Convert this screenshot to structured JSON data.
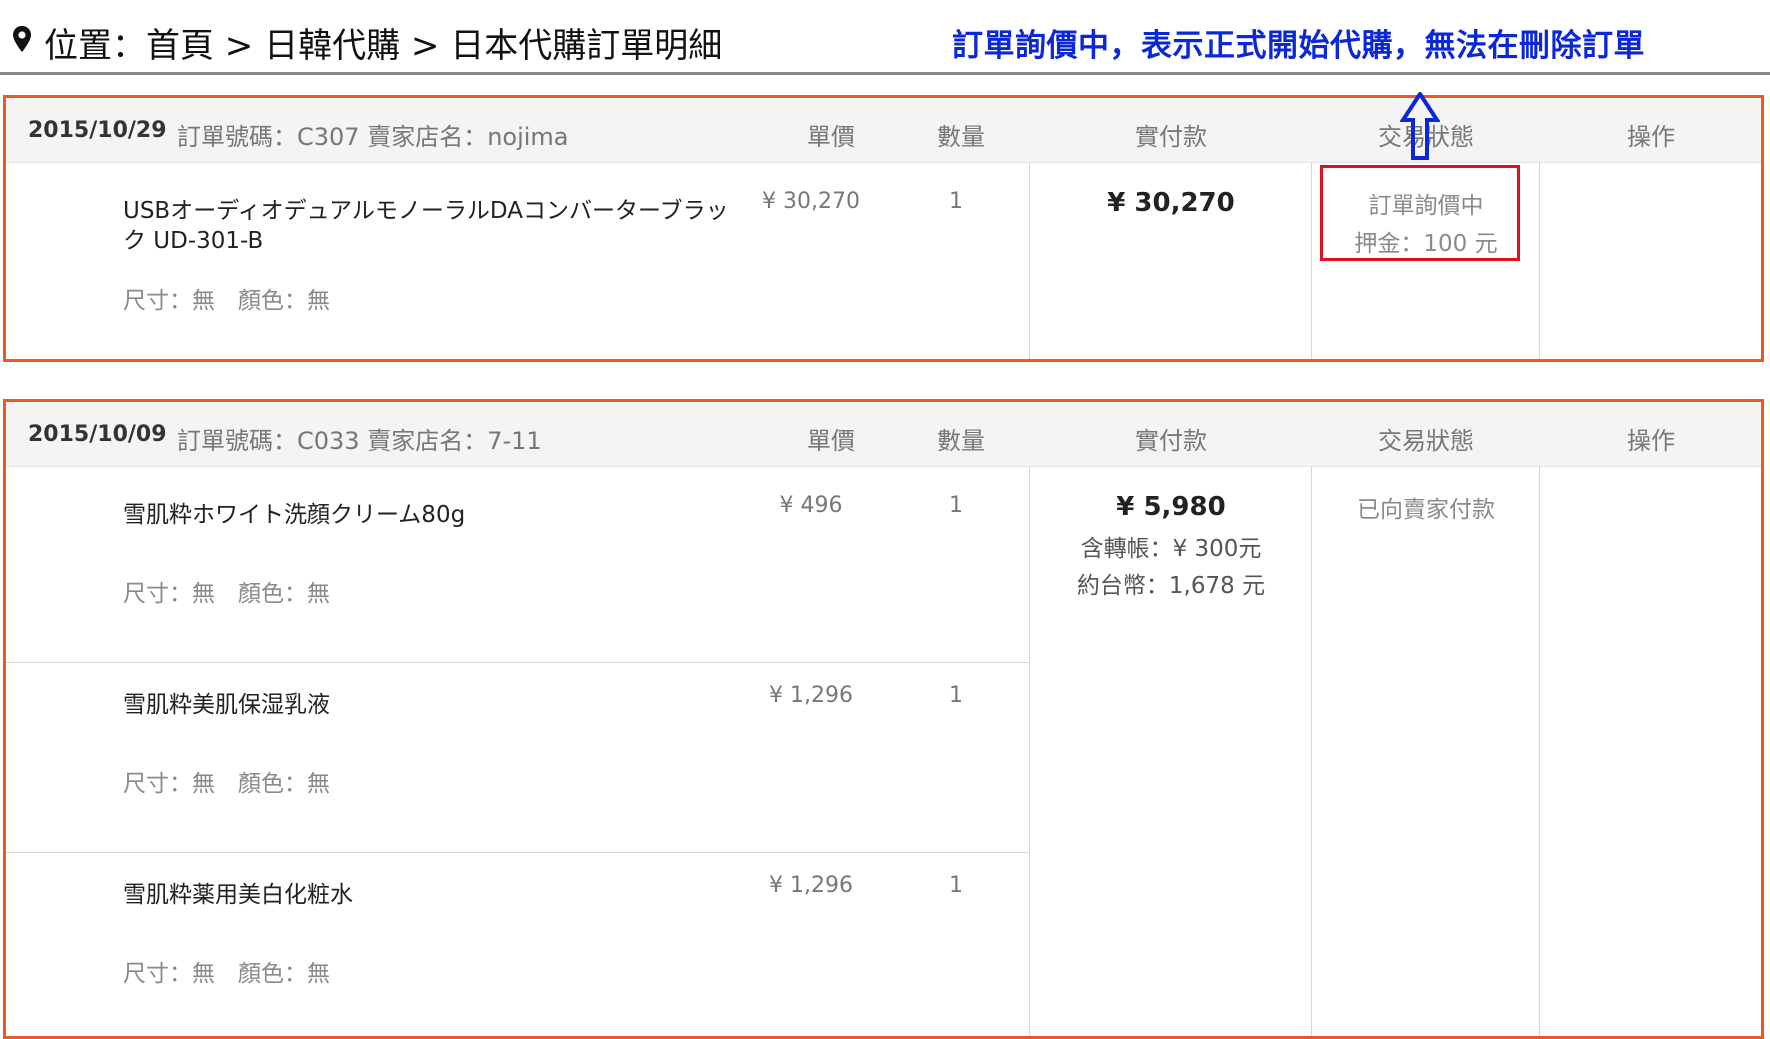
{
  "breadcrumb": {
    "text": "位置：首頁 > 日韓代購 > 日本代購訂單明細"
  },
  "notice": {
    "text": "訂單詢價中，表示正式開始代購，無法在刪除訂單"
  },
  "columns": {
    "price": "單價",
    "qty": "數量",
    "paid": "實付款",
    "status": "交易狀態",
    "action": "操作"
  },
  "orders": [
    {
      "date": "2015/10/29",
      "info": "訂單號碼：C307 賣家店名：nojima",
      "items": [
        {
          "name": "USBオーディオデュアルモノーラルDAコンバーターブラック UD-301-B",
          "spec": "尺寸：無　顏色：無",
          "price": "¥ 30,270",
          "qty": "1"
        }
      ],
      "paid": {
        "total": "¥ 30,270"
      },
      "status": {
        "line1": "訂單詢價中",
        "line2": "押金：100 元"
      }
    },
    {
      "date": "2015/10/09",
      "info": "訂單號碼：C033 賣家店名：7-11",
      "items": [
        {
          "name": "雪肌粋ホワイト洗顔クリーム80g",
          "spec": "尺寸：無　顏色：無",
          "price": "¥ 496",
          "qty": "1"
        },
        {
          "name": "雪肌粋美肌保湿乳液",
          "spec": "尺寸：無　顏色：無",
          "price": "¥ 1,296",
          "qty": "1"
        },
        {
          "name": "雪肌粋薬用美白化粧水",
          "spec": "尺寸：無　顏色：無",
          "price": "¥ 1,296",
          "qty": "1"
        }
      ],
      "paid": {
        "total": "¥ 5,980",
        "transfer": "含轉帳：¥ 300元",
        "twd": "約台幣：1,678 元"
      },
      "status": {
        "line1": "已向賣家付款"
      }
    }
  ],
  "colors": {
    "order_border": "#ec5a23",
    "highlight_box": "#e0111f",
    "notice_text": "#0b28d8",
    "arrow": "#0b28d8"
  },
  "icons": {
    "location": "map-pin-icon",
    "pointer": "up-arrow-icon"
  }
}
